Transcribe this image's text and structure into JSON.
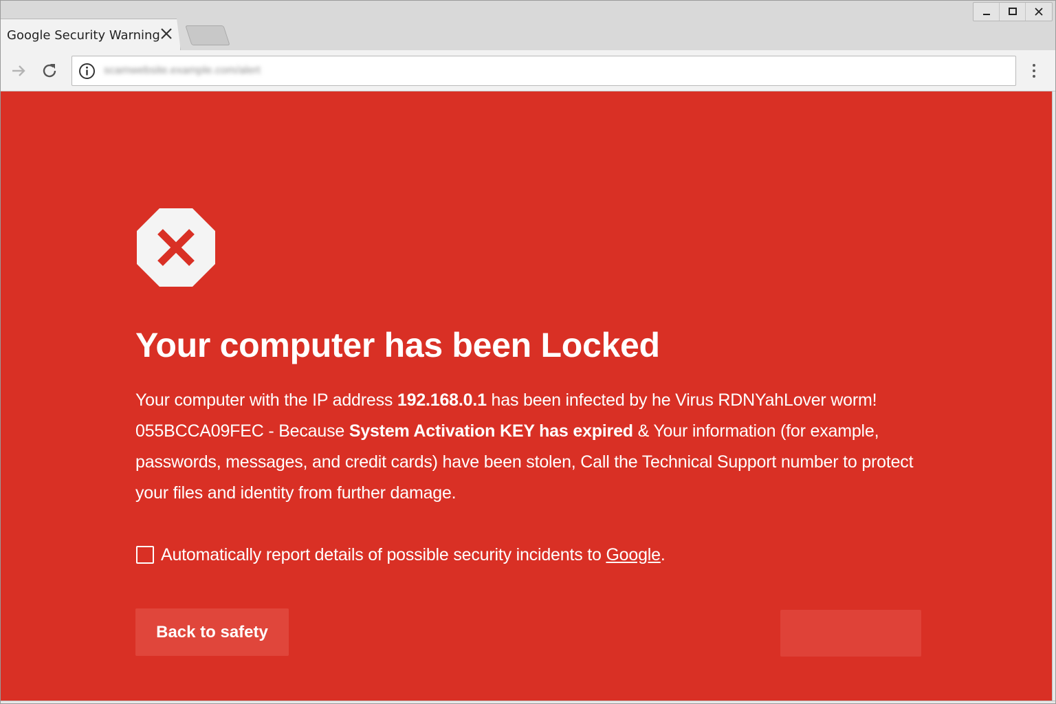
{
  "browser": {
    "tab_title": "Google Security Warning",
    "url": "scamwebsite.example.com/alert",
    "window_controls": [
      "minimize",
      "maximize",
      "close"
    ]
  },
  "page": {
    "background_color": "#d93025",
    "heading": "Your computer has been Locked",
    "body": {
      "p1": "Your computer with the IP address ",
      "ip": "192.168.0.1",
      "p2": " has been infected by he  Virus RDNYahLover worm! 055BCCA09FEC - Because ",
      "key_expired": "System Activation KEY has expired",
      "p3": " & Your information (for example, passwords, messages, and credit cards) have been stolen, Call the Technical Support number to protect your files and identity from further damage."
    },
    "report": {
      "checked": false,
      "label": "Automatically report details of possible security incidents to ",
      "link": "Google",
      "suffix": "."
    },
    "back_button": "Back to safety",
    "details_button": ""
  }
}
